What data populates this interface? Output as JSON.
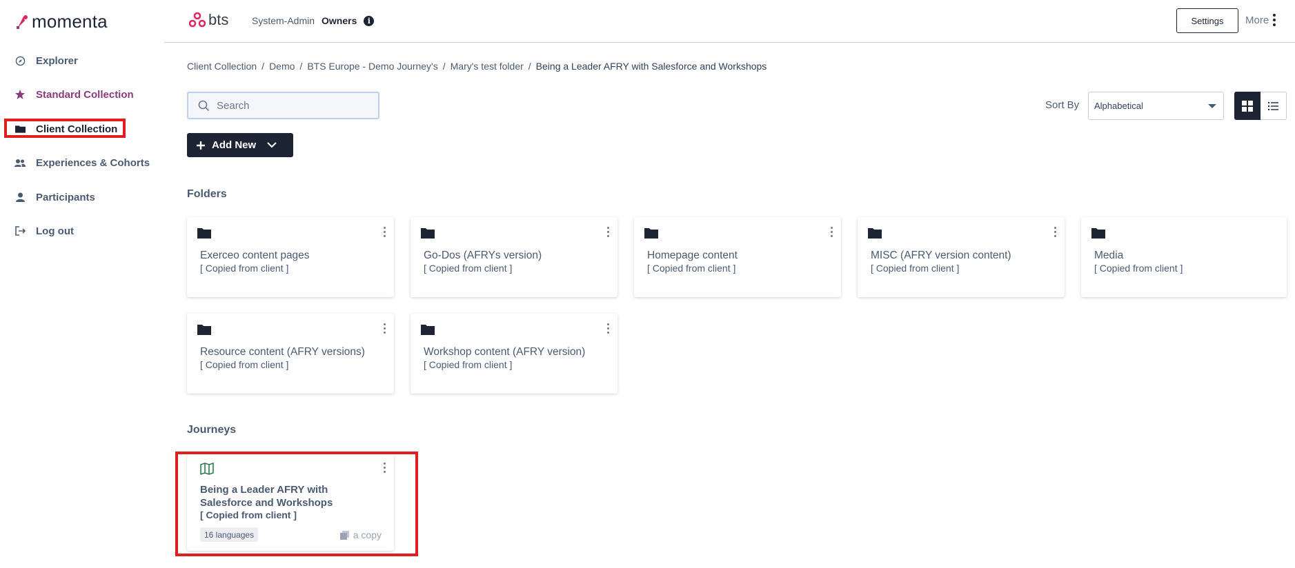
{
  "app": {
    "logo_text": "momenta",
    "client_logo_text": "bts"
  },
  "sidebar": {
    "items": [
      {
        "label": "Explorer",
        "icon": "compass-icon"
      },
      {
        "label": "Standard Collection",
        "icon": "star-icon"
      },
      {
        "label": "Client Collection",
        "icon": "folder-icon"
      },
      {
        "label": "Experiences & Cohorts",
        "icon": "users-icon"
      },
      {
        "label": "Participants",
        "icon": "user-icon"
      },
      {
        "label": "Log out",
        "icon": "logout-icon"
      }
    ]
  },
  "header": {
    "role": "System-Admin",
    "group": "Owners",
    "settings_label": "Settings",
    "more_label": "More"
  },
  "breadcrumb": [
    "Client Collection",
    "Demo",
    "BTS Europe - Demo Journey's",
    "Mary's test folder",
    "Being a Leader AFRY with Salesforce and Workshops"
  ],
  "search": {
    "placeholder": "Search",
    "value": ""
  },
  "sort": {
    "label": "Sort By",
    "selected": "Alphabetical"
  },
  "add_new_label": "Add New",
  "folders": {
    "title": "Folders",
    "items": [
      {
        "name": "Exerceo content pages",
        "note": "[ Copied from client ]"
      },
      {
        "name": "Go-Dos (AFRYs version)",
        "note": "[ Copied from client ]"
      },
      {
        "name": "Homepage content",
        "note": "[ Copied from client ]"
      },
      {
        "name": "MISC (AFRY version content)",
        "note": "[ Copied from client ]"
      },
      {
        "name": "Media",
        "note": "[ Copied from client ]"
      },
      {
        "name": "Resource content (AFRY versions)",
        "note": "[ Copied from client ]"
      },
      {
        "name": "Workshop content (AFRY version)",
        "note": "[ Copied from client ]"
      }
    ]
  },
  "journeys": {
    "title": "Journeys",
    "items": [
      {
        "name": "Being a Leader AFRY with Salesforce and Workshops",
        "note": "[ Copied from client ]",
        "languages": "16 languages",
        "copy_label": "a copy"
      }
    ]
  },
  "colors": {
    "accent_purple": "#8b3a7e",
    "dark": "#1d2433",
    "bts_pink": "#e0245e",
    "highlight_red": "#e01e1e",
    "journey_icon_green": "#2e7d4f"
  }
}
